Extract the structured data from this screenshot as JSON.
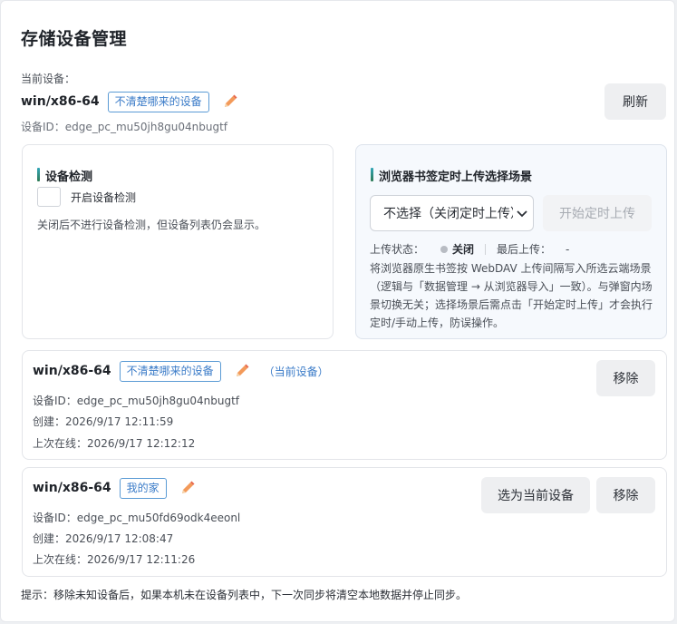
{
  "page": {
    "title": "存储设备管理"
  },
  "current": {
    "label": "当前设备：",
    "name": "win/x86-64",
    "tag": "不清楚哪来的设备",
    "id_line": "设备ID：edge_pc_mu50jh8gu04nbugtf",
    "refresh_label": "刷新"
  },
  "detect": {
    "title": "设备检测",
    "checkbox_label": "开启设备检测",
    "desc": "关闭后不进行设备检测，但设备列表仍会显示。"
  },
  "upload": {
    "title": "浏览器书签定时上传选择场景",
    "select_value": "不选择（关闭定时上传）",
    "start_label": "开始定时上传",
    "status_label": "上传状态：",
    "status_value": "关闭",
    "last_label": "最后上传：",
    "last_value": "-",
    "desc": "将浏览器原生书签按 WebDAV 上传间隔写入所选云端场景（逻辑与「数据管理 → 从浏览器导入」一致）。与弹窗内场景切换无关；选择场景后需点击「开始定时上传」才会执行定时/手动上传，防误操作。"
  },
  "devices": [
    {
      "name": "win/x86-64",
      "tag": "不清楚哪来的设备",
      "current_mark": "（当前设备）",
      "id_line": "设备ID：edge_pc_mu50jh8gu04nbugtf",
      "created": "创建：2026/9/17 12:11:59",
      "last_online": "上次在线：2026/9/17 12:12:12",
      "remove_label": "移除"
    },
    {
      "name": "win/x86-64",
      "tag": "我的家",
      "id_line": "设备ID：edge_pc_mu50fd69odk4eeonl",
      "created": "创建：2026/9/17 12:08:47",
      "last_online": "上次在线：2026/9/17 12:11:26",
      "select_label": "选为当前设备",
      "remove_label": "移除"
    }
  ],
  "hint": "提示：移除未知设备后，如果本机未在设备列表中，下一次同步将清空本地数据并停止同步。",
  "icons": {
    "edit": "pencil-icon",
    "dropdown": "chevron-down-icon",
    "status": "status-dot-icon"
  }
}
